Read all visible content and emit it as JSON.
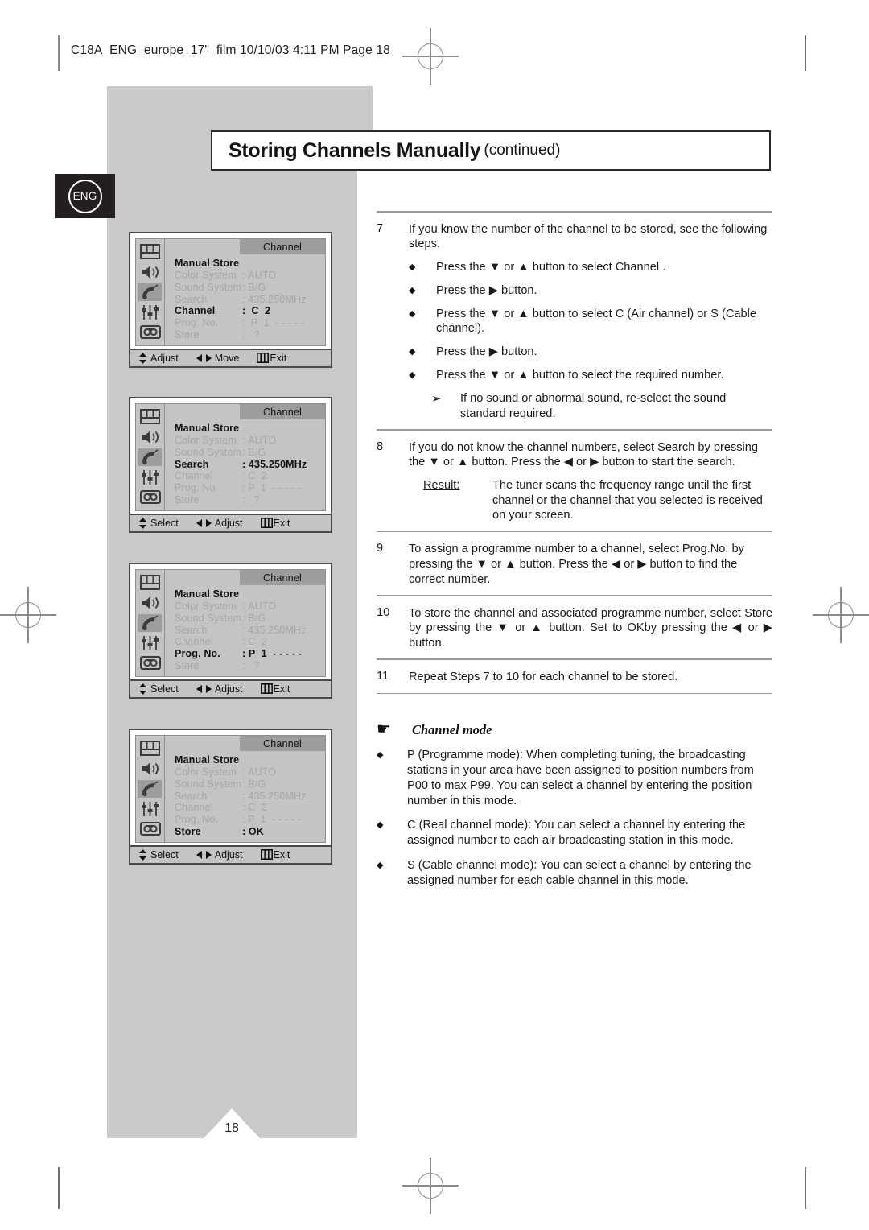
{
  "header": {
    "file_line": "C18A_ENG_europe_17\"_film  10/10/03  4:11 PM  Page 18"
  },
  "title": {
    "main": "Storing Channels Manually",
    "sub": "(continued)"
  },
  "badge": {
    "label": "ENG"
  },
  "page_number": "18",
  "osd_menus": [
    {
      "tab": "Channel",
      "selected_icon_index": 2,
      "rows": [
        {
          "label": "Manual Store",
          "value": "",
          "highlight": false,
          "is_title": true
        },
        {
          "label": "Color System",
          "value": ": AUTO",
          "highlight": false
        },
        {
          "label": "Sound System",
          "value": ": B/G",
          "highlight": false
        },
        {
          "label": "Search",
          "value": ": 435.250MHz",
          "highlight": false
        },
        {
          "label": "Channel",
          "value": ":  C  2",
          "highlight": true
        },
        {
          "label": "Prog. No.",
          "value": ":  P  1  - - - - -",
          "highlight": false
        },
        {
          "label": "Store",
          "value": ":   ?",
          "highlight": false
        }
      ],
      "footer": [
        {
          "glyph": "updown",
          "label": "Adjust"
        },
        {
          "glyph": "leftright",
          "label": "Move"
        },
        {
          "glyph": "menu",
          "label": "Exit"
        }
      ]
    },
    {
      "tab": "Channel",
      "selected_icon_index": 2,
      "rows": [
        {
          "label": "Manual Store",
          "value": "",
          "highlight": false,
          "is_title": true
        },
        {
          "label": "Color System",
          "value": ": AUTO",
          "highlight": false
        },
        {
          "label": "Sound System",
          "value": ": B/G",
          "highlight": false
        },
        {
          "label": "Search",
          "value": ": 435.250MHz",
          "highlight": true
        },
        {
          "label": "Channel",
          "value": ": C  2",
          "highlight": false
        },
        {
          "label": "Prog. No.",
          "value": ": P  1  - - - - -",
          "highlight": false
        },
        {
          "label": "Store",
          "value": ":   ?",
          "highlight": false
        }
      ],
      "footer": [
        {
          "glyph": "updown",
          "label": "Select"
        },
        {
          "glyph": "leftright",
          "label": "Adjust"
        },
        {
          "glyph": "menu",
          "label": "Exit"
        }
      ]
    },
    {
      "tab": "Channel",
      "selected_icon_index": 2,
      "rows": [
        {
          "label": "Manual Store",
          "value": "",
          "highlight": false,
          "is_title": true
        },
        {
          "label": "Color System",
          "value": ": AUTO",
          "highlight": false
        },
        {
          "label": "Sound System",
          "value": ": B/G",
          "highlight": false
        },
        {
          "label": "Search",
          "value": ": 435.250MHz",
          "highlight": false
        },
        {
          "label": "Channel",
          "value": ": C  2",
          "highlight": false
        },
        {
          "label": "Prog. No.",
          "value": ": P  1  - - - - -",
          "highlight": true
        },
        {
          "label": "Store",
          "value": ":   ?",
          "highlight": false
        }
      ],
      "footer": [
        {
          "glyph": "updown",
          "label": "Select"
        },
        {
          "glyph": "leftright",
          "label": "Adjust"
        },
        {
          "glyph": "menu",
          "label": "Exit"
        }
      ]
    },
    {
      "tab": "Channel",
      "selected_icon_index": 2,
      "rows": [
        {
          "label": "Manual Store",
          "value": "",
          "highlight": false,
          "is_title": true
        },
        {
          "label": "Color System",
          "value": ": AUTO",
          "highlight": false
        },
        {
          "label": "Sound System",
          "value": ": B/G",
          "highlight": false
        },
        {
          "label": "Search",
          "value": ": 435.250MHz",
          "highlight": false
        },
        {
          "label": "Channel",
          "value": ": C  2",
          "highlight": false
        },
        {
          "label": "Prog. No.",
          "value": ": P  1  - - - - -",
          "highlight": false
        },
        {
          "label": "Store",
          "value": ": OK",
          "highlight": true
        }
      ],
      "footer": [
        {
          "glyph": "updown",
          "label": "Select"
        },
        {
          "glyph": "leftright",
          "label": "Adjust"
        },
        {
          "glyph": "menu",
          "label": "Exit"
        }
      ]
    }
  ],
  "steps": {
    "s7": {
      "num": "7",
      "text": "If you know the number of the channel to be stored, see the following steps.",
      "bullets": [
        "Press the ▼ or ▲ button to select Channel .",
        "Press the ▶ button.",
        "Press the ▼ or ▲ button to select C (Air channel) or S (Cable channel).",
        "Press the ▶ button.",
        "Press the ▼ or ▲ button to select the required number."
      ],
      "note": "If no sound or abnormal sound, re-select the sound standard required."
    },
    "s8": {
      "num": "8",
      "text": "If you do not know the channel numbers, select Search  by pressing the ▼ or ▲ button. Press the ◀ or ▶ button to start the search.",
      "result_label": "Result:",
      "result_text": "The tuner scans the frequency range until the first channel or the channel that you selected is received on your screen."
    },
    "s9": {
      "num": "9",
      "text": "To assign a programme number to a channel, select Prog.No.   by pressing the ▼ or ▲ button. Press the ◀ or ▶ button to find the correct number."
    },
    "s10": {
      "num": "10",
      "text": "To store the channel and associated programme number, select Store  by pressing the ▼ or ▲ button. Set to OKby pressing the ◀ or ▶ button."
    },
    "s11": {
      "num": "11",
      "text": "Repeat Steps 7 to 10 for each channel to be stored."
    }
  },
  "channel_mode": {
    "heading": "Channel mode",
    "items": [
      "P (Programme mode): When completing tuning, the broadcasting stations in your area have been assigned to position numbers from P00 to max P99. You can select a channel by entering the position number in this mode.",
      "C (Real channel mode): You can select a channel by entering the assigned number to each air broadcasting station in this mode.",
      "S (Cable channel mode): You can select a channel by entering the assigned number for each cable channel in this mode."
    ]
  },
  "colors": {
    "gray_panel": "#c9c9c9",
    "osd_bg": "#c4c4c4",
    "osd_tab": "#9d9d9d",
    "osd_dim_text": "#a6a6a6",
    "ink": "#1a1a1a",
    "badge_bg": "#231f20"
  }
}
